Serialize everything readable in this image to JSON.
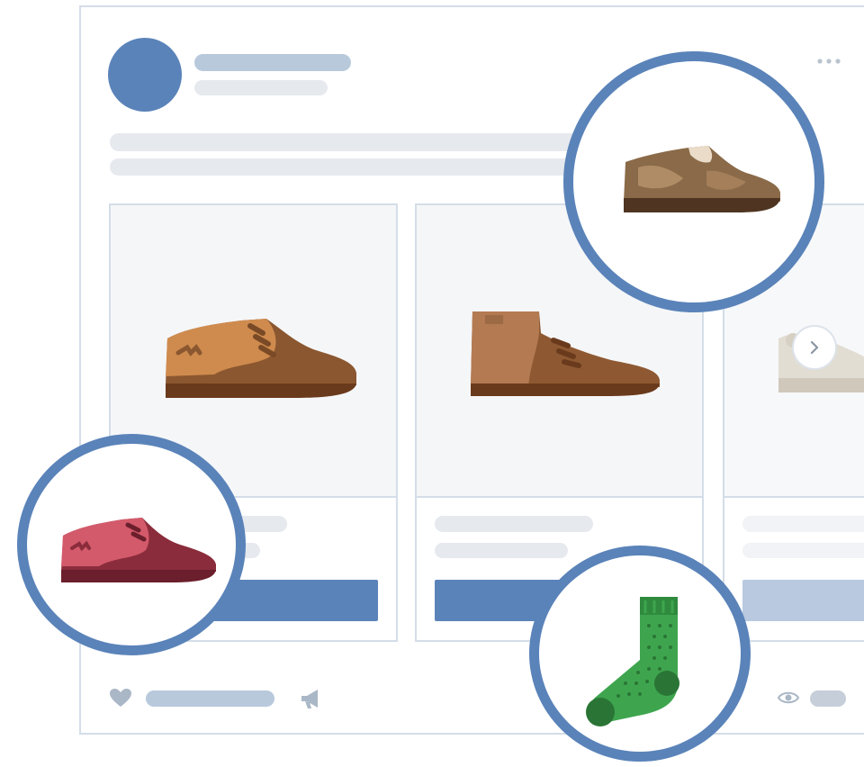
{
  "post": {
    "author_avatar": "avatar",
    "menu_icon": "more-dots-icon"
  },
  "products": [
    {
      "image": "brown-oxford-shoe",
      "button_color": "#5a83b9"
    },
    {
      "image": "brown-chukka-boot",
      "button_color": "#5a83b9"
    },
    {
      "image": "beige-sneaker",
      "button_color": "#b8c9e0"
    }
  ],
  "highlights": [
    {
      "image": "camo-oxford-shoe"
    },
    {
      "image": "red-oxford-shoe"
    },
    {
      "image": "green-polka-dot-sock"
    }
  ],
  "footer": {
    "like_icon": "heart-icon",
    "share_icon": "megaphone-icon",
    "views_icon": "eye-icon"
  },
  "colors": {
    "accent": "#5a83b9",
    "placeholder_dark": "#b8c9dc",
    "placeholder_light": "#e6e9ee",
    "border": "#d4dde8"
  }
}
